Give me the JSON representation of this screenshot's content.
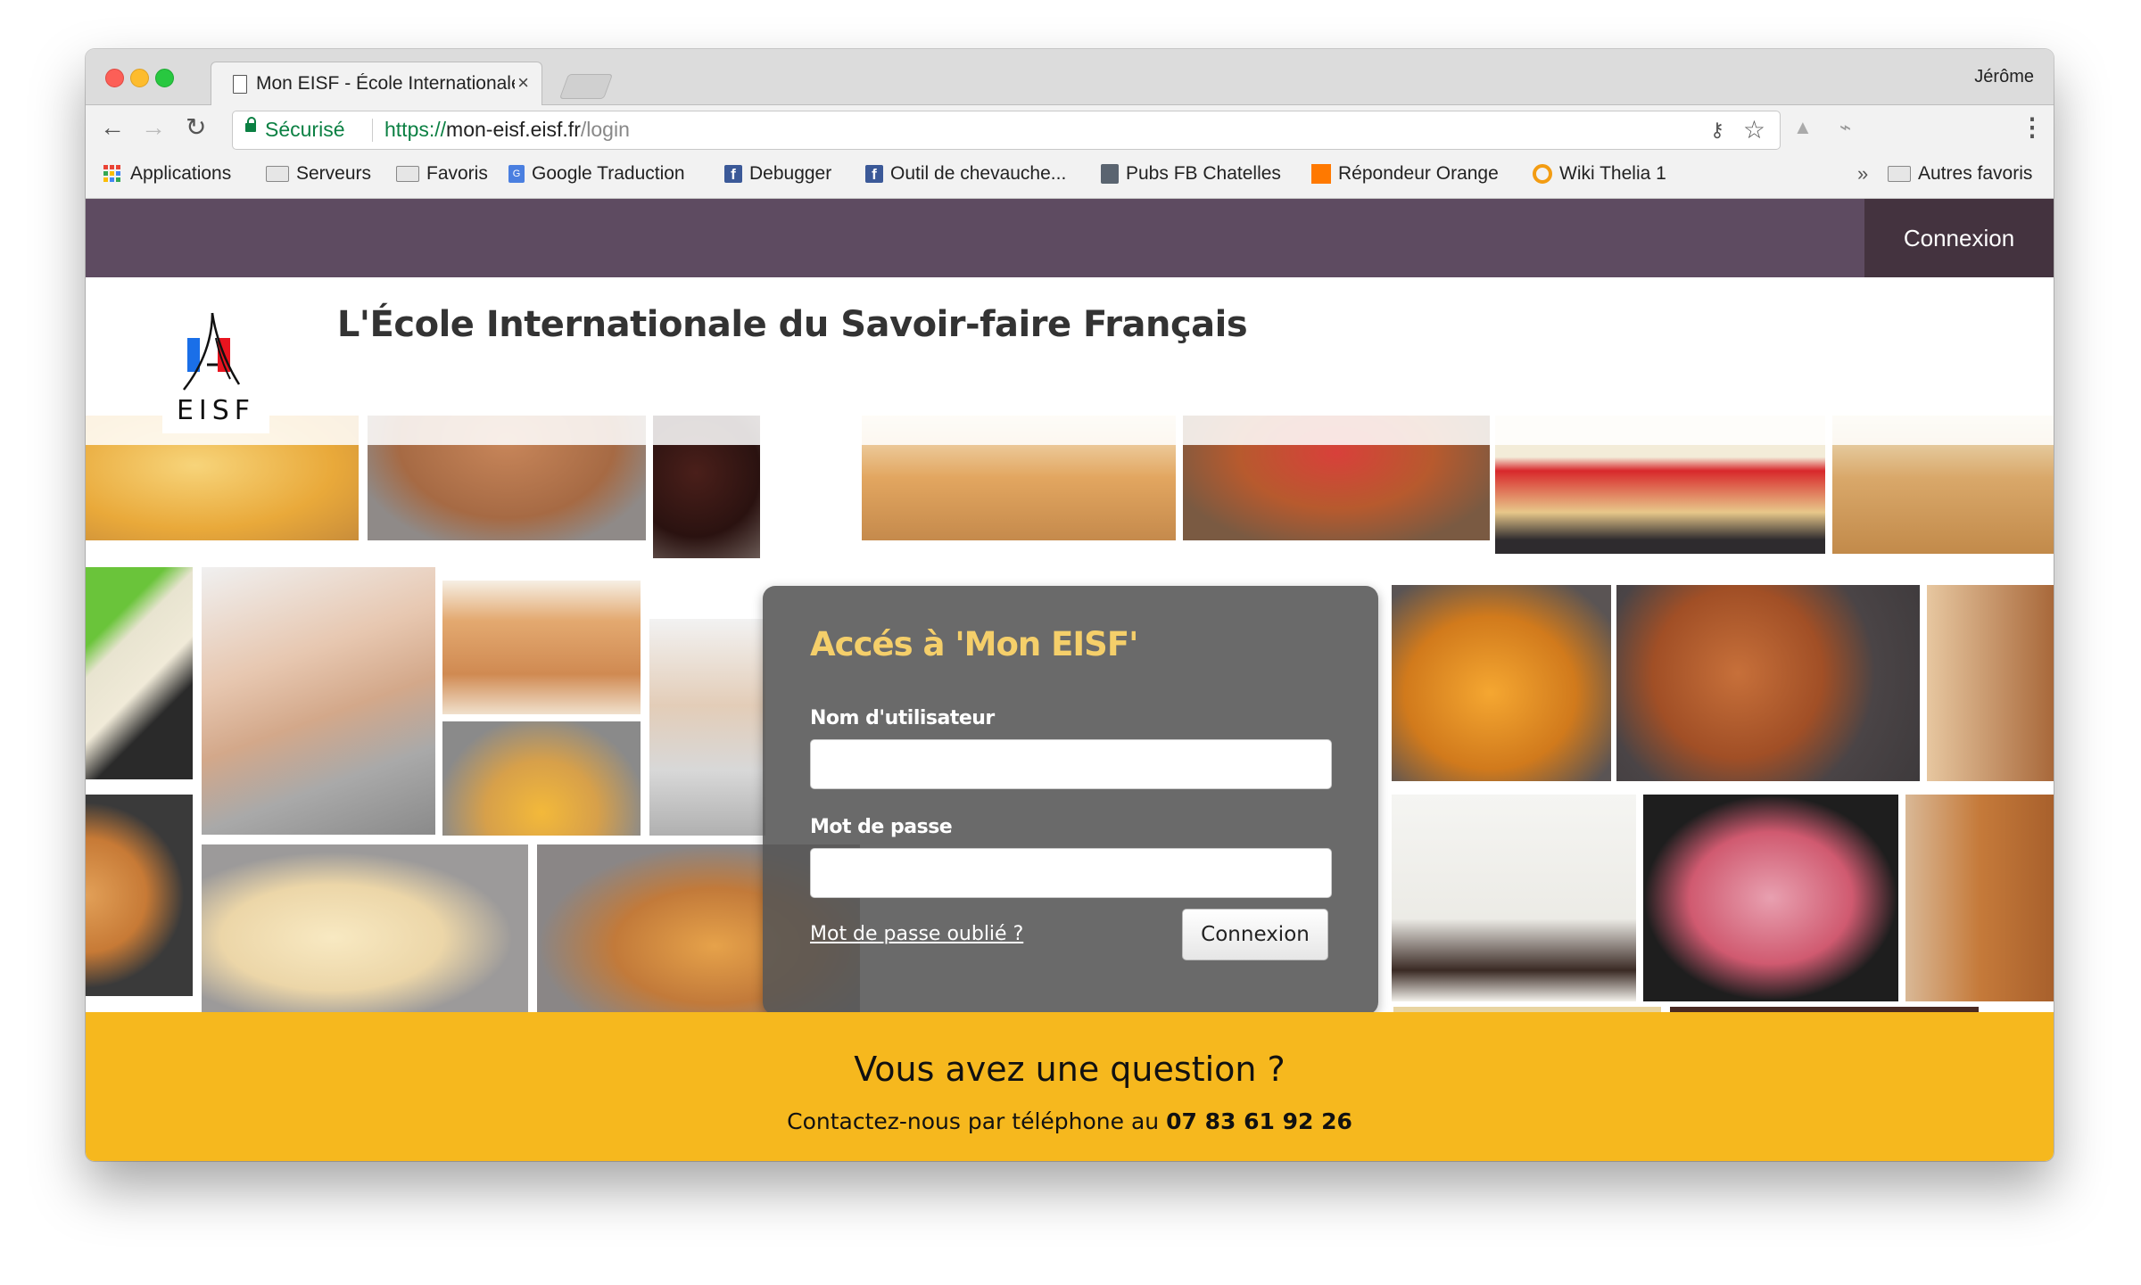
{
  "browser": {
    "tab_title": "Mon EISF - École Internationale du Savoir-faire Français",
    "tab_close": "×",
    "profile_name": "Jérôme",
    "security_label": "Sécurisé",
    "url_scheme": "https://",
    "url_host": "mon-eisf.eisf.fr",
    "url_path": "/login",
    "icons": {
      "back": "←",
      "forward": "→",
      "reload": "↻",
      "key": "⚷",
      "star": "☆",
      "drive": "▲",
      "extension": "⌁",
      "menu": "⋮",
      "chevron": "»"
    },
    "bookmarks": [
      {
        "label": "Applications",
        "icon": "apps-icon"
      },
      {
        "label": "Serveurs",
        "icon": "folder-icon"
      },
      {
        "label": "Favoris",
        "icon": "folder-icon"
      },
      {
        "label": "Google Traduction",
        "icon": "google-translate-icon"
      },
      {
        "label": "Debugger",
        "icon": "facebook-icon"
      },
      {
        "label": "Outil de chevauche...",
        "icon": "facebook-icon"
      },
      {
        "label": "Pubs FB Chatelles",
        "icon": "bookmark-page-icon"
      },
      {
        "label": "Répondeur Orange",
        "icon": "orange-icon"
      },
      {
        "label": "Wiki Thelia 1",
        "icon": "wiki-icon"
      }
    ],
    "other_bookmarks": "Autres favoris"
  },
  "page": {
    "nav_login": "Connexion",
    "logo_text": "EISF",
    "site_title": "L'École Internationale du Savoir-faire Français",
    "login": {
      "title": "Accés à 'Mon EISF'",
      "username_label": "Nom d'utilisateur",
      "username_value": "",
      "password_label": "Mot de passe",
      "password_value": "",
      "forgot_link": "Mot de passe oublié ?",
      "submit_label": "Connexion"
    },
    "footer": {
      "question": "Vous avez une question ?",
      "contact_text": "Contactez-nous par téléphone au ",
      "phone": "07 83 61 92 26"
    }
  },
  "colors": {
    "nav_bg": "#5e4b61",
    "nav_login_bg": "#44333f",
    "login_title": "#f5cf6a",
    "footer_bg": "#f6b81e",
    "secure_green": "#0b8043"
  }
}
